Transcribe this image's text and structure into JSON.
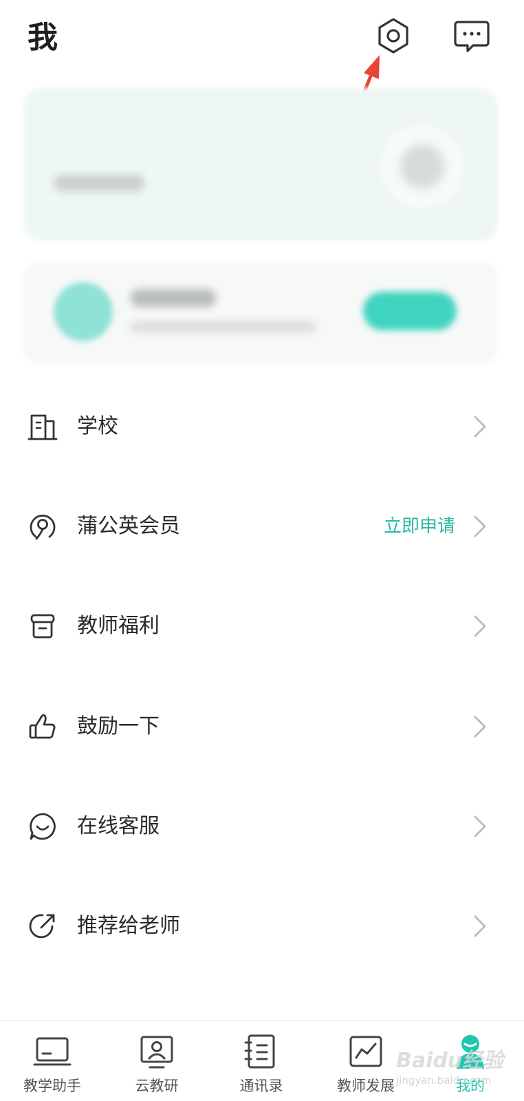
{
  "header": {
    "title": "我",
    "settings_icon": "settings-hexagon-icon",
    "messages_icon": "message-bubble-icon"
  },
  "profile_cards": {
    "blurred": true
  },
  "menu": {
    "items": [
      {
        "label": "学校",
        "icon": "school-building-icon",
        "extra": ""
      },
      {
        "label": "蒲公英会员",
        "icon": "dandelion-icon",
        "extra": "立即申请"
      },
      {
        "label": "教师福利",
        "icon": "gift-box-icon",
        "extra": ""
      },
      {
        "label": "鼓励一下",
        "icon": "thumbs-up-icon",
        "extra": ""
      },
      {
        "label": "在线客服",
        "icon": "chat-smile-icon",
        "extra": ""
      },
      {
        "label": "推荐给老师",
        "icon": "share-arrow-icon",
        "extra": ""
      }
    ]
  },
  "tabbar": {
    "tabs": [
      {
        "label": "教学助手",
        "icon": "laptop-icon",
        "active": false
      },
      {
        "label": "云教研",
        "icon": "person-screen-icon",
        "active": false
      },
      {
        "label": "通讯录",
        "icon": "address-book-icon",
        "active": false
      },
      {
        "label": "教师发展",
        "icon": "trend-chart-icon",
        "active": false
      },
      {
        "label": "我的",
        "icon": "person-icon",
        "active": true
      }
    ]
  },
  "watermark": {
    "main": "Baidu经验",
    "sub": "jingyan.baidu.com"
  },
  "colors": {
    "accent": "#1fc6b0",
    "annotation_arrow": "#e8443a",
    "text": "#2a2a2a",
    "chevron": "#bdbdbd"
  }
}
